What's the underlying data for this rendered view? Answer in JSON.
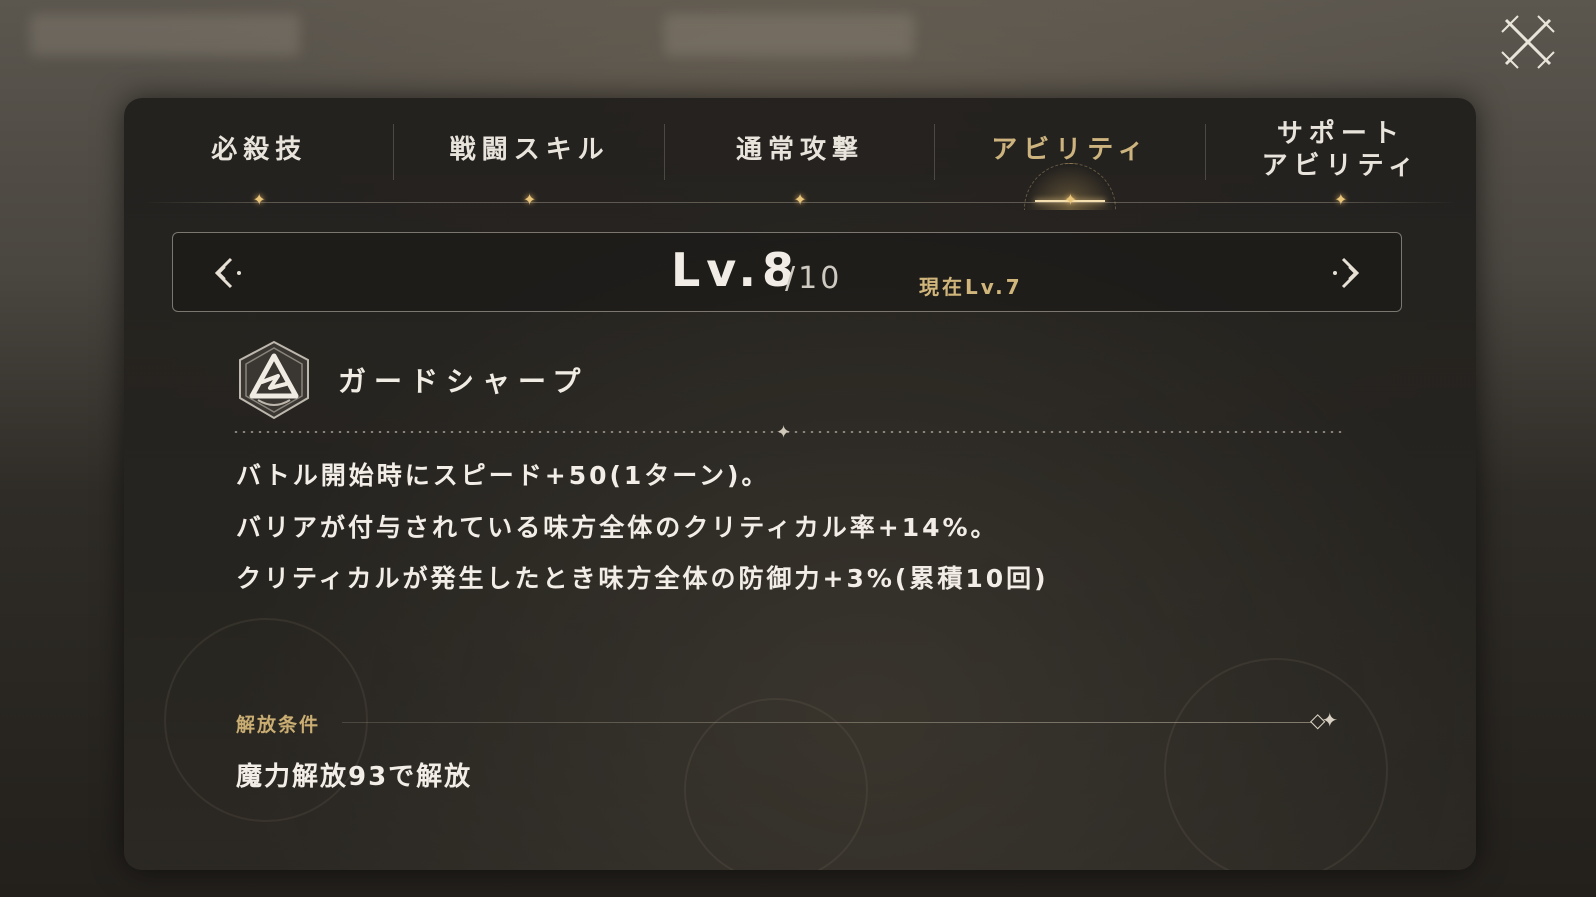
{
  "tabs": [
    {
      "label": "必殺技",
      "active": false
    },
    {
      "label": "戦闘スキル",
      "active": false
    },
    {
      "label": "通常攻撃",
      "active": false
    },
    {
      "label": "アビリティ",
      "active": true
    },
    {
      "label": "サポート\nアビリティ",
      "active": false
    }
  ],
  "level": {
    "selected": "Lv.8",
    "max": "/10",
    "current": "現在Lv.7"
  },
  "skill": {
    "icon": "shield-triangle-emblem-icon",
    "name": "ガードシャープ"
  },
  "description": [
    "バトル開始時にスピード+50(1ターン)。",
    "バリアが付与されている味方全体のクリティカル率+14%。",
    "クリティカルが発生したとき味方全体の防御力+3%(累積10回)"
  ],
  "unlock": {
    "label": "解放条件",
    "text": "魔力解放93で解放"
  },
  "colors": {
    "accent_gold": "#cdb37e",
    "text_primary": "#f2eee7",
    "panel_bg": "#24221f"
  }
}
